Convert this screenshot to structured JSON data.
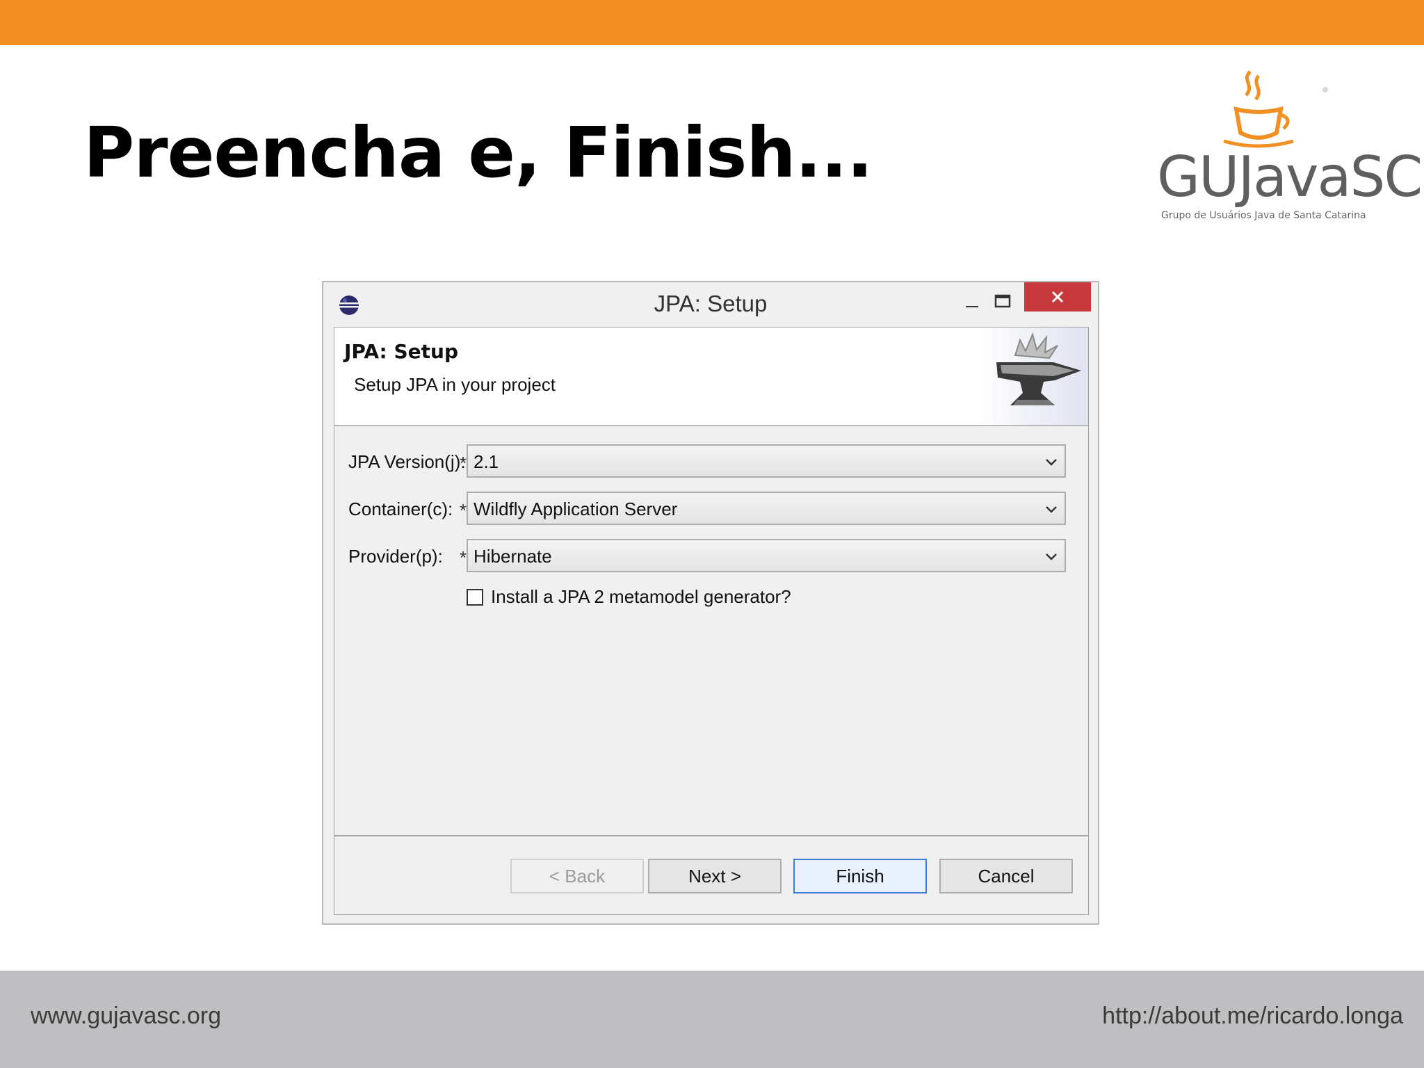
{
  "slide": {
    "title": "Preencha e, Finish...",
    "logo": {
      "name": "GUJavaSC",
      "subtitle": "Grupo de Usuários Java de Santa Catarina",
      "icon": "coffee-cup-icon"
    },
    "footer_left": "www.gujavasc.org",
    "footer_right": "http://about.me/ricardo.longa",
    "accent_color": "#f28f22",
    "footer_color": "#bfbec1"
  },
  "dialog": {
    "window_title": "JPA: Setup",
    "window_icon": "eclipse-icon",
    "controls": {
      "minimize": "minimize-icon",
      "maximize": "maximize-icon",
      "close": "close-icon"
    },
    "banner": {
      "title": "JPA: Setup",
      "description": "Setup JPA in your project",
      "art": "anvil-icon"
    },
    "fields": [
      {
        "label": "JPA Version(j):",
        "required": "*",
        "value": "2.1"
      },
      {
        "label": "Container(c):",
        "required": "*",
        "value": "Wildfly Application Server"
      },
      {
        "label": "Provider(p):",
        "required": "*",
        "value": "Hibernate"
      }
    ],
    "checkbox": {
      "label": "Install a JPA 2 metamodel generator?",
      "checked": false
    },
    "buttons": {
      "back": "< Back",
      "next": "Next >",
      "finish": "Finish",
      "cancel": "Cancel"
    }
  }
}
